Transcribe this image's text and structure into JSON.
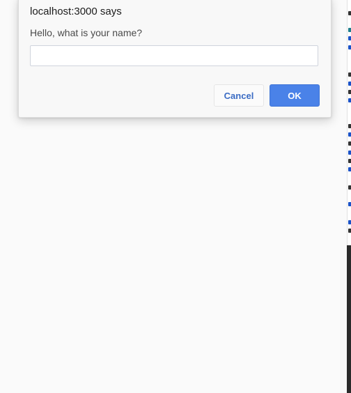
{
  "dialog": {
    "title": "localhost:3000 says",
    "message": "Hello, what is your name?",
    "input_value": "",
    "cancel_label": "Cancel",
    "ok_label": "OK"
  },
  "colors": {
    "background": "#fafafa",
    "dialog_background": "#f8f8f8",
    "ok_button": "#4a82e8",
    "cancel_text": "#3b6cc4",
    "side_panel_dark": "#2b2b2b"
  }
}
